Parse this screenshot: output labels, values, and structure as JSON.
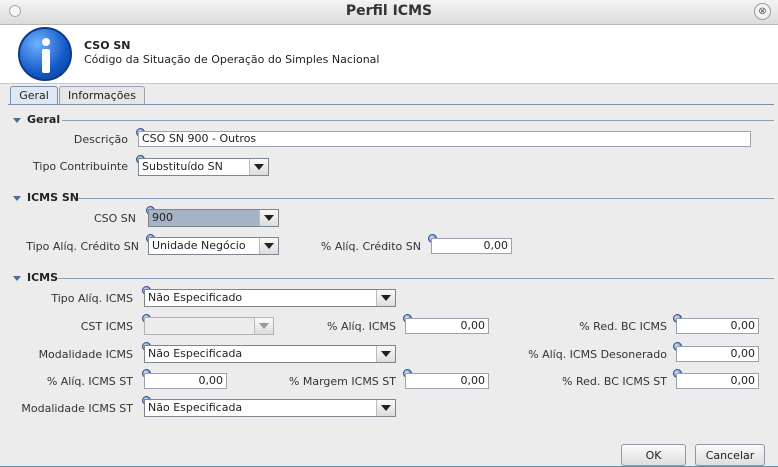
{
  "window": {
    "title": "Perfil ICMS",
    "close_glyph": "⊗"
  },
  "header": {
    "title": "CSO SN",
    "subtitle": "Código da Situação de Operação do Simples Nacional",
    "icon": "info-icon"
  },
  "tabs": [
    {
      "label": "Geral"
    },
    {
      "label": "Informações"
    }
  ],
  "geral": {
    "section_title": "Geral",
    "descricao_label": "Descrição",
    "descricao_value": "CSO SN 900 - Outros",
    "tipo_contribuinte_label": "Tipo Contribuinte",
    "tipo_contribuinte_value": "Substituído SN"
  },
  "icms_sn": {
    "section_title": "ICMS SN",
    "cso_sn_label": "CSO SN",
    "cso_sn_value": "900",
    "tipo_aliq_credito_label": "Tipo Alíq. Crédito SN",
    "tipo_aliq_credito_value": "Unidade Negócio",
    "aliq_credito_label": "% Alíq. Crédito SN",
    "aliq_credito_value": "0,00"
  },
  "icms": {
    "section_title": "ICMS",
    "tipo_aliq_label": "Tipo Alíq. ICMS",
    "tipo_aliq_value": "Não Especificado",
    "cst_label": "CST ICMS",
    "cst_value": "",
    "aliq_icms_label": "% Alíq. ICMS",
    "aliq_icms_value": "0,00",
    "red_bc_label": "% Red. BC ICMS",
    "red_bc_value": "0,00",
    "modalidade_label": "Modalidade ICMS",
    "modalidade_value": "Não Especificada",
    "aliq_desonerado_label": "% Alíq. ICMS Desonerado",
    "aliq_desonerado_value": "0,00",
    "aliq_st_label": "% Alíq. ICMS ST",
    "aliq_st_value": "0,00",
    "margem_st_label": "% Margem ICMS ST",
    "margem_st_value": "0,00",
    "red_bc_st_label": "% Red. BC ICMS ST",
    "red_bc_st_value": "0,00",
    "modalidade_st_label": "Modalidade ICMS ST",
    "modalidade_st_value": "Não Especificada"
  },
  "buttons": {
    "ok": "OK",
    "cancel": "Cancelar"
  }
}
